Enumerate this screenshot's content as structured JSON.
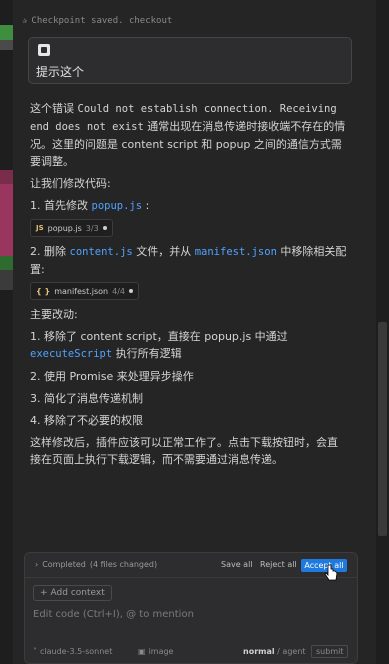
{
  "checkpoint": {
    "text": "Checkpoint saved. checkout"
  },
  "user_message": {
    "text": "提示这个"
  },
  "answer": {
    "para1_prefix": "这个错误",
    "para1_code": "Could not establish connection. Receiving end does not exist",
    "para1_suffix": "通常出现在消息传递时接收端不存在的情况。这里的问题是 content script 和 popup 之间的通信方式需要调整。",
    "intro": "让我们修改代码:",
    "step1_prefix": "1. 首先修改",
    "step1_code": "popup.js",
    "step1_suffix": ":",
    "chip1": {
      "icon": "JS",
      "name": "popup.js",
      "count": "3/3"
    },
    "step2_prefix": "2. 删除",
    "step2_code1": "content.js",
    "step2_mid": "文件，并从",
    "step2_code2": "manifest.json",
    "step2_suffix": "中移除相关配置:",
    "chip2": {
      "icon": "{ }",
      "name": "manifest.json",
      "count": "4/4"
    },
    "changes_title": "主要改动:",
    "change1_prefix": "1. 移除了 content script，直接在 popup.js 中通过",
    "change1_code": "executeScript",
    "change1_suffix": "执行所有逻辑",
    "change2": "2. 使用 Promise 来处理异步操作",
    "change3": "3. 简化了消息传递机制",
    "change4": "4. 移除了不必要的权限",
    "closing": "这样修改后，插件应该可以正常工作了。点击下载按钮时，会直接在页面上执行下载逻辑，而不需要通过消息传递。"
  },
  "composer": {
    "status": "Completed",
    "status_count": "(4 files changed)",
    "save_all": "Save all",
    "reject_all": "Reject all",
    "accept_all": "Accept all",
    "add_context": "Add context",
    "placeholder": "Edit code (Ctrl+I), @ to mention",
    "model": "claude-3.5-sonnet",
    "image": "image",
    "mode_bold": "normal",
    "mode_rest": "/ agent",
    "submit": "submit"
  },
  "colors": {
    "accent": "#1f7ae0",
    "code": "#4fa3ff",
    "background": "#252526"
  },
  "icons": [
    "checkpoint-icon",
    "user-badge-icon",
    "js-file-icon",
    "json-file-icon",
    "chevron-right-icon",
    "plus-icon",
    "image-icon",
    "cursor-hand-icon"
  ]
}
